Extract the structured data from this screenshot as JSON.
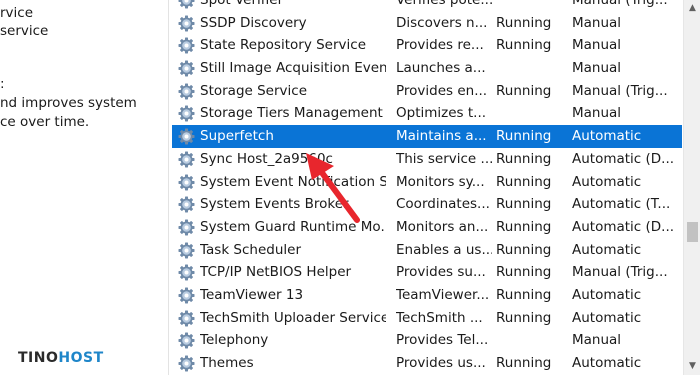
{
  "left_pane": {
    "lines": [
      "rvice",
      "service",
      ":",
      "nd improves system",
      "ce over time."
    ]
  },
  "services": [
    {
      "name": "Spot Verifier",
      "description": "Verifies pote...",
      "status": "",
      "startup": "Manual (Trig...",
      "icon": "gear-icon"
    },
    {
      "name": "SSDP Discovery",
      "description": "Discovers n...",
      "status": "Running",
      "startup": "Manual",
      "icon": "gear-icon"
    },
    {
      "name": "State Repository Service",
      "description": "Provides re...",
      "status": "Running",
      "startup": "Manual",
      "icon": "gear-icon"
    },
    {
      "name": "Still Image Acquisition Events",
      "description": "Launches a...",
      "status": "",
      "startup": "Manual",
      "icon": "gear-icon"
    },
    {
      "name": "Storage Service",
      "description": "Provides en...",
      "status": "Running",
      "startup": "Manual (Trig...",
      "icon": "gear-icon"
    },
    {
      "name": "Storage Tiers Management",
      "description": "Optimizes t...",
      "status": "",
      "startup": "Manual",
      "icon": "gear-icon"
    },
    {
      "name": "Superfetch",
      "description": "Maintains a...",
      "status": "Running",
      "startup": "Automatic",
      "icon": "gear-icon",
      "selected": true
    },
    {
      "name": "Sync Host_2a9560c",
      "description": "This service ...",
      "status": "Running",
      "startup": "Automatic (D...",
      "icon": "gear-icon"
    },
    {
      "name": "System Event Notification S...",
      "description": "Monitors sy...",
      "status": "Running",
      "startup": "Automatic",
      "icon": "gear-icon"
    },
    {
      "name": "System Events Broker",
      "description": "Coordinates...",
      "status": "Running",
      "startup": "Automatic (T...",
      "icon": "gear-icon"
    },
    {
      "name": "System Guard Runtime Mo...",
      "description": "Monitors an...",
      "status": "Running",
      "startup": "Automatic (D...",
      "icon": "gear-icon"
    },
    {
      "name": "Task Scheduler",
      "description": "Enables a us...",
      "status": "Running",
      "startup": "Automatic",
      "icon": "gear-icon"
    },
    {
      "name": "TCP/IP NetBIOS Helper",
      "description": "Provides su...",
      "status": "Running",
      "startup": "Manual (Trig...",
      "icon": "gear-icon"
    },
    {
      "name": "TeamViewer 13",
      "description": "TeamViewer...",
      "status": "Running",
      "startup": "Automatic",
      "icon": "gear-icon"
    },
    {
      "name": "TechSmith Uploader Service",
      "description": "TechSmith ...",
      "status": "Running",
      "startup": "Automatic",
      "icon": "gear-icon"
    },
    {
      "name": "Telephony",
      "description": "Provides Tel...",
      "status": "",
      "startup": "Manual",
      "icon": "gear-icon"
    },
    {
      "name": "Themes",
      "description": "Provides us...",
      "status": "Running",
      "startup": "Automatic",
      "icon": "gear-icon"
    }
  ],
  "watermark": {
    "text_a": "TINO",
    "text_b": "HOST"
  },
  "colors": {
    "selection": "#0a74d6",
    "annotation_arrow": "#e8262d",
    "logo_accent": "#1f86c9"
  }
}
